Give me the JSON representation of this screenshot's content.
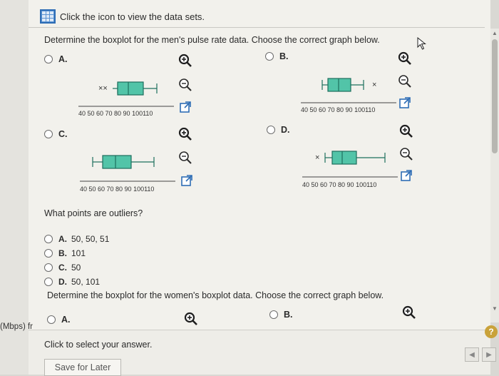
{
  "topbar": {
    "text": "Click the icon to view the data sets."
  },
  "question1": {
    "prompt": "Determine the boxplot for the men's pulse rate data. Choose the correct graph below.",
    "options": [
      {
        "letter": "A.",
        "outliers": "xx left",
        "ticks": "40 50 60 70 80 90 100110"
      },
      {
        "letter": "B.",
        "outliers": "x right",
        "ticks": "40 50 60 70 80 90 100110"
      },
      {
        "letter": "C.",
        "outliers": "none",
        "ticks": "40 50 60 70 80 90 100110"
      },
      {
        "letter": "D.",
        "outliers": "x left",
        "ticks": "40 50 60 70 80 90 100110"
      }
    ]
  },
  "question2": {
    "prompt": "What points are outliers?",
    "answers": [
      {
        "letter": "A.",
        "text": "50, 50, 51"
      },
      {
        "letter": "B.",
        "text": "101"
      },
      {
        "letter": "C.",
        "text": "50"
      },
      {
        "letter": "D.",
        "text": "50, 101"
      }
    ]
  },
  "question3": {
    "prompt": "Determine the boxplot for the women's boxplot data. Choose the correct graph below.",
    "options": [
      {
        "letter": "A."
      },
      {
        "letter": "B."
      }
    ]
  },
  "footer": {
    "instruction": "Click to select your answer.",
    "save_label": "Save for Later"
  },
  "left_note": "(Mbps) fr",
  "help_label": "?",
  "nav": {
    "prev": "◀",
    "next": "▶"
  },
  "colors": {
    "box_fill": "#52c4a8",
    "box_stroke": "#1d6f5d",
    "link_blue": "#2e6db5"
  }
}
